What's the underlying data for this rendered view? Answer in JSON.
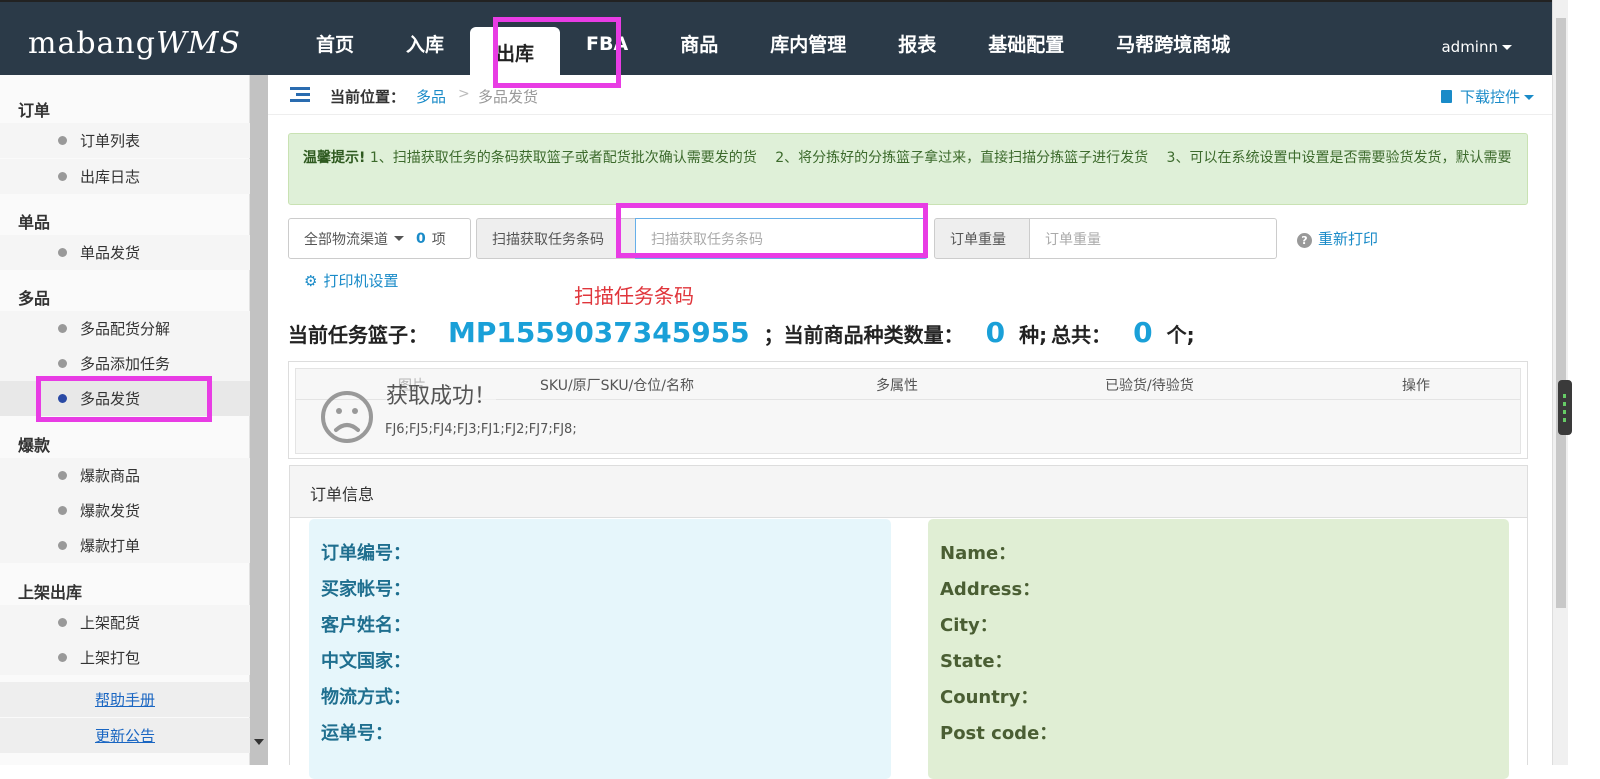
{
  "app": {
    "logo_main": "mabang",
    "logo_suffix": "WMS"
  },
  "nav": {
    "items": [
      {
        "label": "首页"
      },
      {
        "label": "入库"
      },
      {
        "label": "出库"
      },
      {
        "label": "FBA"
      },
      {
        "label": "商品"
      },
      {
        "label": "库内管理"
      },
      {
        "label": "报表"
      },
      {
        "label": "基础配置"
      },
      {
        "label": "马帮跨境商城"
      }
    ],
    "active": "出库",
    "user": "adminn"
  },
  "sidebar": {
    "sections": [
      {
        "title": "订单",
        "items": [
          "订单列表",
          "出库日志"
        ]
      },
      {
        "title": "单品",
        "items": [
          "单品发货"
        ]
      },
      {
        "title": "多品",
        "items": [
          "多品配货分解",
          "多品添加任务",
          "多品发货"
        ]
      },
      {
        "title": "爆款",
        "items": [
          "爆款商品",
          "爆款发货",
          "爆款打单"
        ]
      },
      {
        "title": "上架出库",
        "items": [
          "上架配货",
          "上架打包"
        ]
      }
    ],
    "active_item": "多品发货",
    "links": [
      "帮助手册",
      "更新公告"
    ]
  },
  "breadcrumb": {
    "label": "当前位置：",
    "parent": "多品",
    "separator": ">",
    "current": "多品发货",
    "download": "下载控件"
  },
  "tip": {
    "title": "温馨提示!",
    "text": " 1、扫描获取任务的条码获取篮子或者配货批次确认需要发的货　 2、将分拣好的分拣篮子拿过来，直接扫描分拣篮子进行发货　 3、可以在系统设置中设置是否需要验货发货，默认需要"
  },
  "controls": {
    "channel_select": "全部物流渠道",
    "channel_count": "0",
    "channel_unit": "项",
    "scan_label": "扫描获取任务条码",
    "scan_placeholder": "扫描获取任务条码",
    "weight_label": "订单重量",
    "weight_placeholder": "订单重量",
    "reprint": "重新打印",
    "printer_settings": "打印机设置",
    "scan_annotation": "扫描任务条码"
  },
  "task": {
    "basket_label": "当前任务篮子：",
    "basket_code": "MP1559037345955",
    "kinds_label": "；当前商品种类数量：",
    "kinds_count": "0",
    "kinds_unit": "种;",
    "total_label": "总共：",
    "total_count": "0",
    "total_unit": "个;"
  },
  "table": {
    "columns": [
      "图片",
      "SKU/原厂SKU/仓位/名称",
      "多属性",
      "已验货/待验货",
      "操作"
    ],
    "message": "获取成功！",
    "codes": "FJ6;FJ5;FJ4;FJ3;FJ1;FJ2;FJ7;FJ8;"
  },
  "order": {
    "title": "订单信息",
    "left_fields": [
      "订单编号：",
      "买家帐号：",
      "客户姓名：",
      "中文国家：",
      "物流方式：",
      "运单号："
    ],
    "right_fields": [
      "Name：",
      "Address：",
      "City：",
      "State：",
      "Country：",
      "Post code："
    ]
  },
  "colors": {
    "nav_bg": "#2b3a48",
    "highlight": "#e83ce4",
    "accent": "#1aa0d8",
    "tip_bg": "#dff0d8"
  }
}
